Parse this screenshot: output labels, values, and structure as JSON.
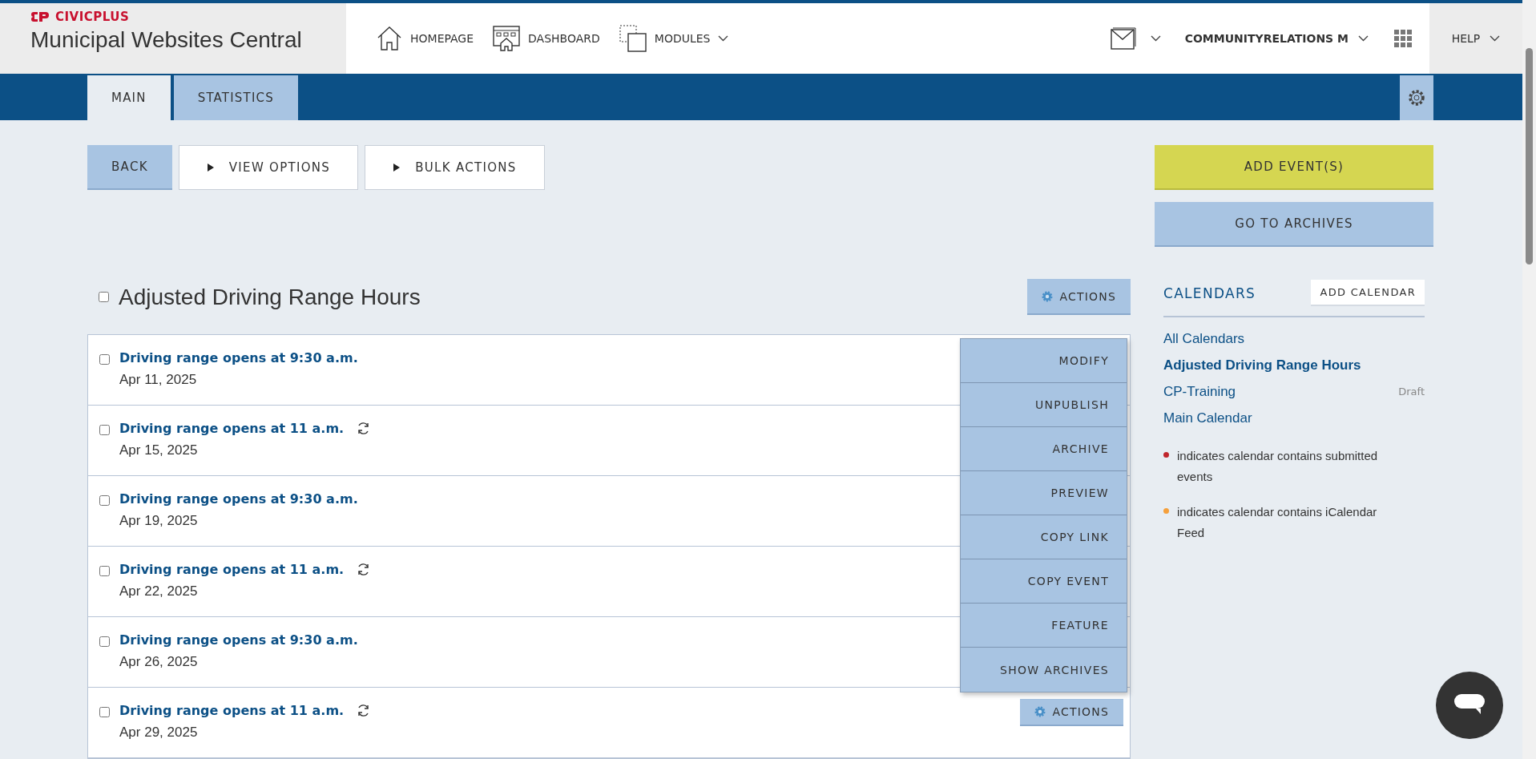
{
  "header": {
    "brand": "CIVICPLUS",
    "site_title": "Municipal Websites Central",
    "nav": [
      {
        "label": "HOMEPAGE",
        "kind": "home",
        "dropdown": false
      },
      {
        "label": "DASHBOARD",
        "kind": "dashboard",
        "dropdown": false
      },
      {
        "label": "MODULES",
        "kind": "modules",
        "dropdown": true
      }
    ],
    "user": "COMMUNITYRELATIONS M",
    "help": "HELP"
  },
  "tabs": [
    {
      "label": "MAIN",
      "selected": true
    },
    {
      "label": "STATISTICS",
      "selected": false
    }
  ],
  "toolbar": {
    "back": "BACK",
    "toggles": [
      "VIEW OPTIONS",
      "BULK ACTIONS"
    ],
    "add_events": "ADD EVENT(S)",
    "go_to_archives": "GO TO ARCHIVES"
  },
  "calendar": {
    "title": "Adjusted Driving Range Hours",
    "checked": false,
    "actions": "ACTIONS"
  },
  "events": [
    {
      "title": "Driving range opens at 9:30 a.m.",
      "date": "Apr 11, 2025",
      "recurring": false,
      "checked": false
    },
    {
      "title": "Driving range opens at 11 a.m.",
      "date": "Apr 15, 2025",
      "recurring": true,
      "checked": false
    },
    {
      "title": "Driving range opens at 9:30 a.m.",
      "date": "Apr 19, 2025",
      "recurring": false,
      "checked": false
    },
    {
      "title": "Driving range opens at 11 a.m.",
      "date": "Apr 22, 2025",
      "recurring": true,
      "checked": false
    },
    {
      "title": "Driving range opens at 9:30 a.m.",
      "date": "Apr 26, 2025",
      "recurring": false,
      "checked": false
    },
    {
      "title": "Driving range opens at 11 a.m.",
      "date": "Apr 29, 2025",
      "recurring": true,
      "checked": false,
      "actions": "ACTIONS"
    }
  ],
  "actions_menu": [
    "MODIFY",
    "UNPUBLISH",
    "ARCHIVE",
    "PREVIEW",
    "COPY LINK",
    "COPY EVENT",
    "FEATURE",
    "SHOW ARCHIVES"
  ],
  "sidebar": {
    "heading": "CALENDARS",
    "add_button": "ADD CALENDAR",
    "calendars": [
      {
        "name": "All Calendars",
        "selected": false
      },
      {
        "name": "Adjusted Driving Range Hours",
        "selected": true
      },
      {
        "name": "CP-Training",
        "selected": false,
        "status": "Draft"
      },
      {
        "name": "Main Calendar",
        "selected": false
      }
    ],
    "legend": [
      {
        "color": "#c0262d",
        "text": "indicates calendar contains submitted events"
      },
      {
        "color": "#f5a03c",
        "text": "indicates calendar contains iCalendar Feed"
      }
    ]
  }
}
